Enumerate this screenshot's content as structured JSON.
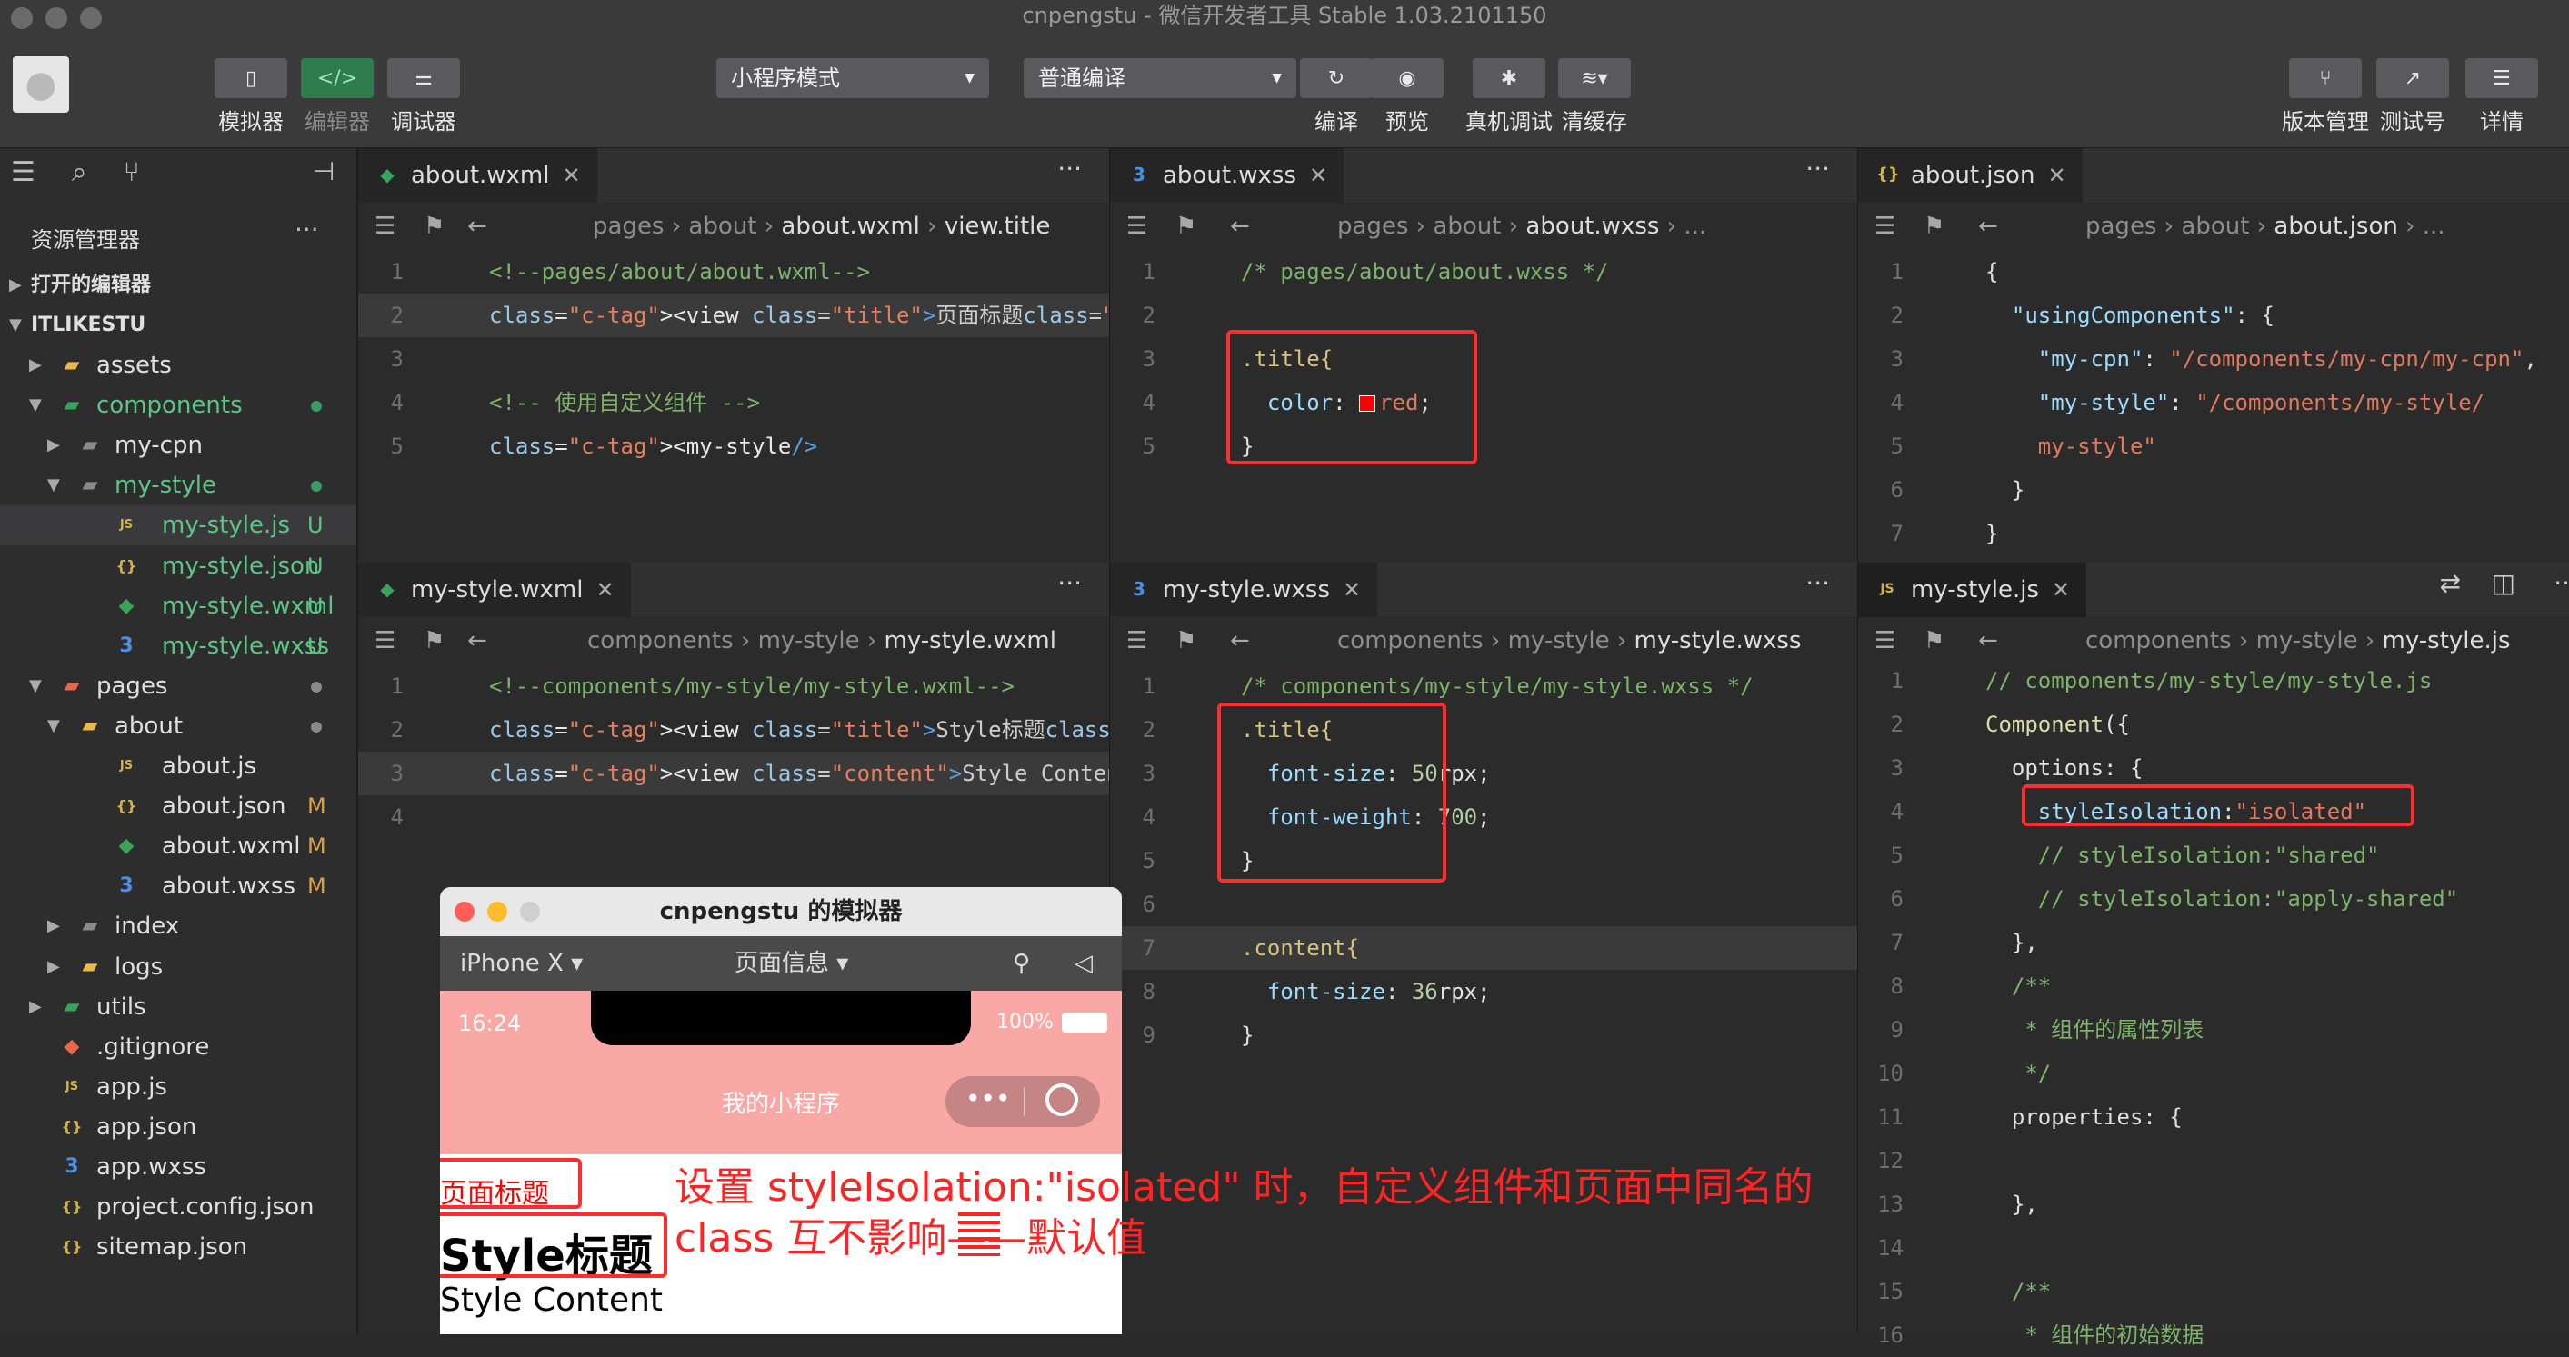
{
  "window": {
    "title": "cnpengstu - 微信开发者工具 Stable 1.03.2101150"
  },
  "toolbar": {
    "simulator": "模拟器",
    "editor": "编辑器",
    "debugger": "调试器",
    "mode_select": "小程序模式",
    "compile_select": "普通编译",
    "compile": "编译",
    "preview": "预览",
    "device_debug": "真机调试",
    "clear_cache": "清缓存",
    "version": "版本管理",
    "test_id": "测试号",
    "details": "详情"
  },
  "explorer": {
    "title": "资源管理器",
    "open_editors": "打开的编辑器",
    "project": "ITLIKESTU",
    "items": [
      {
        "name": "assets",
        "badge": ""
      },
      {
        "name": "components",
        "badge": ""
      },
      {
        "name": "my-cpn",
        "badge": ""
      },
      {
        "name": "my-style",
        "badge": ""
      },
      {
        "name": "my-style.js",
        "badge": "U"
      },
      {
        "name": "my-style.json",
        "badge": "U"
      },
      {
        "name": "my-style.wxml",
        "badge": "U"
      },
      {
        "name": "my-style.wxss",
        "badge": "U"
      },
      {
        "name": "pages",
        "badge": ""
      },
      {
        "name": "about",
        "badge": ""
      },
      {
        "name": "about.js",
        "badge": ""
      },
      {
        "name": "about.json",
        "badge": "M"
      },
      {
        "name": "about.wxml",
        "badge": "M"
      },
      {
        "name": "about.wxss",
        "badge": "M"
      },
      {
        "name": "index",
        "badge": ""
      },
      {
        "name": "logs",
        "badge": ""
      },
      {
        "name": "utils",
        "badge": ""
      },
      {
        "name": ".gitignore",
        "badge": ""
      },
      {
        "name": "app.js",
        "badge": ""
      },
      {
        "name": "app.json",
        "badge": ""
      },
      {
        "name": "app.wxss",
        "badge": ""
      },
      {
        "name": "project.config.json",
        "badge": ""
      },
      {
        "name": "sitemap.json",
        "badge": ""
      }
    ]
  },
  "crumbs": {
    "pages": "pages",
    "about": "about",
    "components": "components",
    "my_style": "my-style",
    "view_title": "view.title",
    "ellipsis": "..."
  },
  "editors": {
    "about_wxml": {
      "tab": "about.wxml",
      "lines": [
        "<!--pages/about/about.wxml-->",
        "<view class=\"title\">页面标题</view>",
        "",
        "<!-- 使用自定义组件 -->",
        "<my-style/>"
      ]
    },
    "about_wxss": {
      "tab": "about.wxss",
      "lines": [
        "/* pages/about/about.wxss */",
        "",
        ".title{",
        "  color: red;",
        "}"
      ]
    },
    "about_json": {
      "tab": "about.json",
      "lines": [
        "{",
        "  \"usingComponents\": {",
        "    \"my-cpn\": \"/components/my-cpn/my-cpn\",",
        "    \"my-style\": \"/components/my-style/",
        "    my-style\"",
        "  }",
        "}"
      ]
    },
    "my_style_wxml": {
      "tab": "my-style.wxml",
      "lines": [
        "<!--components/my-style/my-style.wxml-->",
        "<view class=\"title\">Style标题</view>",
        "<view class=\"content\">Style Content</view>",
        ""
      ]
    },
    "my_style_wxss": {
      "tab": "my-style.wxss",
      "lines": [
        "/* components/my-style/my-style.wxss */",
        ".title{",
        "  font-size: 50rpx;",
        "  font-weight: 700;",
        "}",
        "",
        ".content{",
        "  font-size: 36rpx;",
        "}"
      ]
    },
    "my_style_js": {
      "tab": "my-style.js",
      "lines": [
        "// components/my-style/my-style.js",
        "Component({",
        "  options: {",
        "    styleIsolation:\"isolated\"",
        "    // styleIsolation:\"shared\"",
        "    // styleIsolation:\"apply-shared\"",
        "  },",
        "  /**",
        "   * 组件的属性列表",
        "   */",
        "  properties: {",
        "",
        "  },",
        "",
        "  /**",
        "   * 组件的初始数据"
      ]
    }
  },
  "simulator": {
    "title": "cnpengstu 的模拟器",
    "device": "iPhone X",
    "page_info": "页面信息",
    "time": "16:24",
    "battery": "100%",
    "app_title": "我的小程序",
    "page_title_text": "页面标题",
    "style_title_text": "Style标题",
    "style_content_text": "Style Content"
  },
  "annotation": {
    "line1": "设置 styleIsolation:\"isolated\" 时，自定义组件和页面中同名的",
    "line2": "class 互不影响——默认值"
  },
  "colors": {
    "annotation_red": "#ff2d2d",
    "header_pink": "#f9a8a6",
    "editor_bg": "#2b2b2c"
  }
}
